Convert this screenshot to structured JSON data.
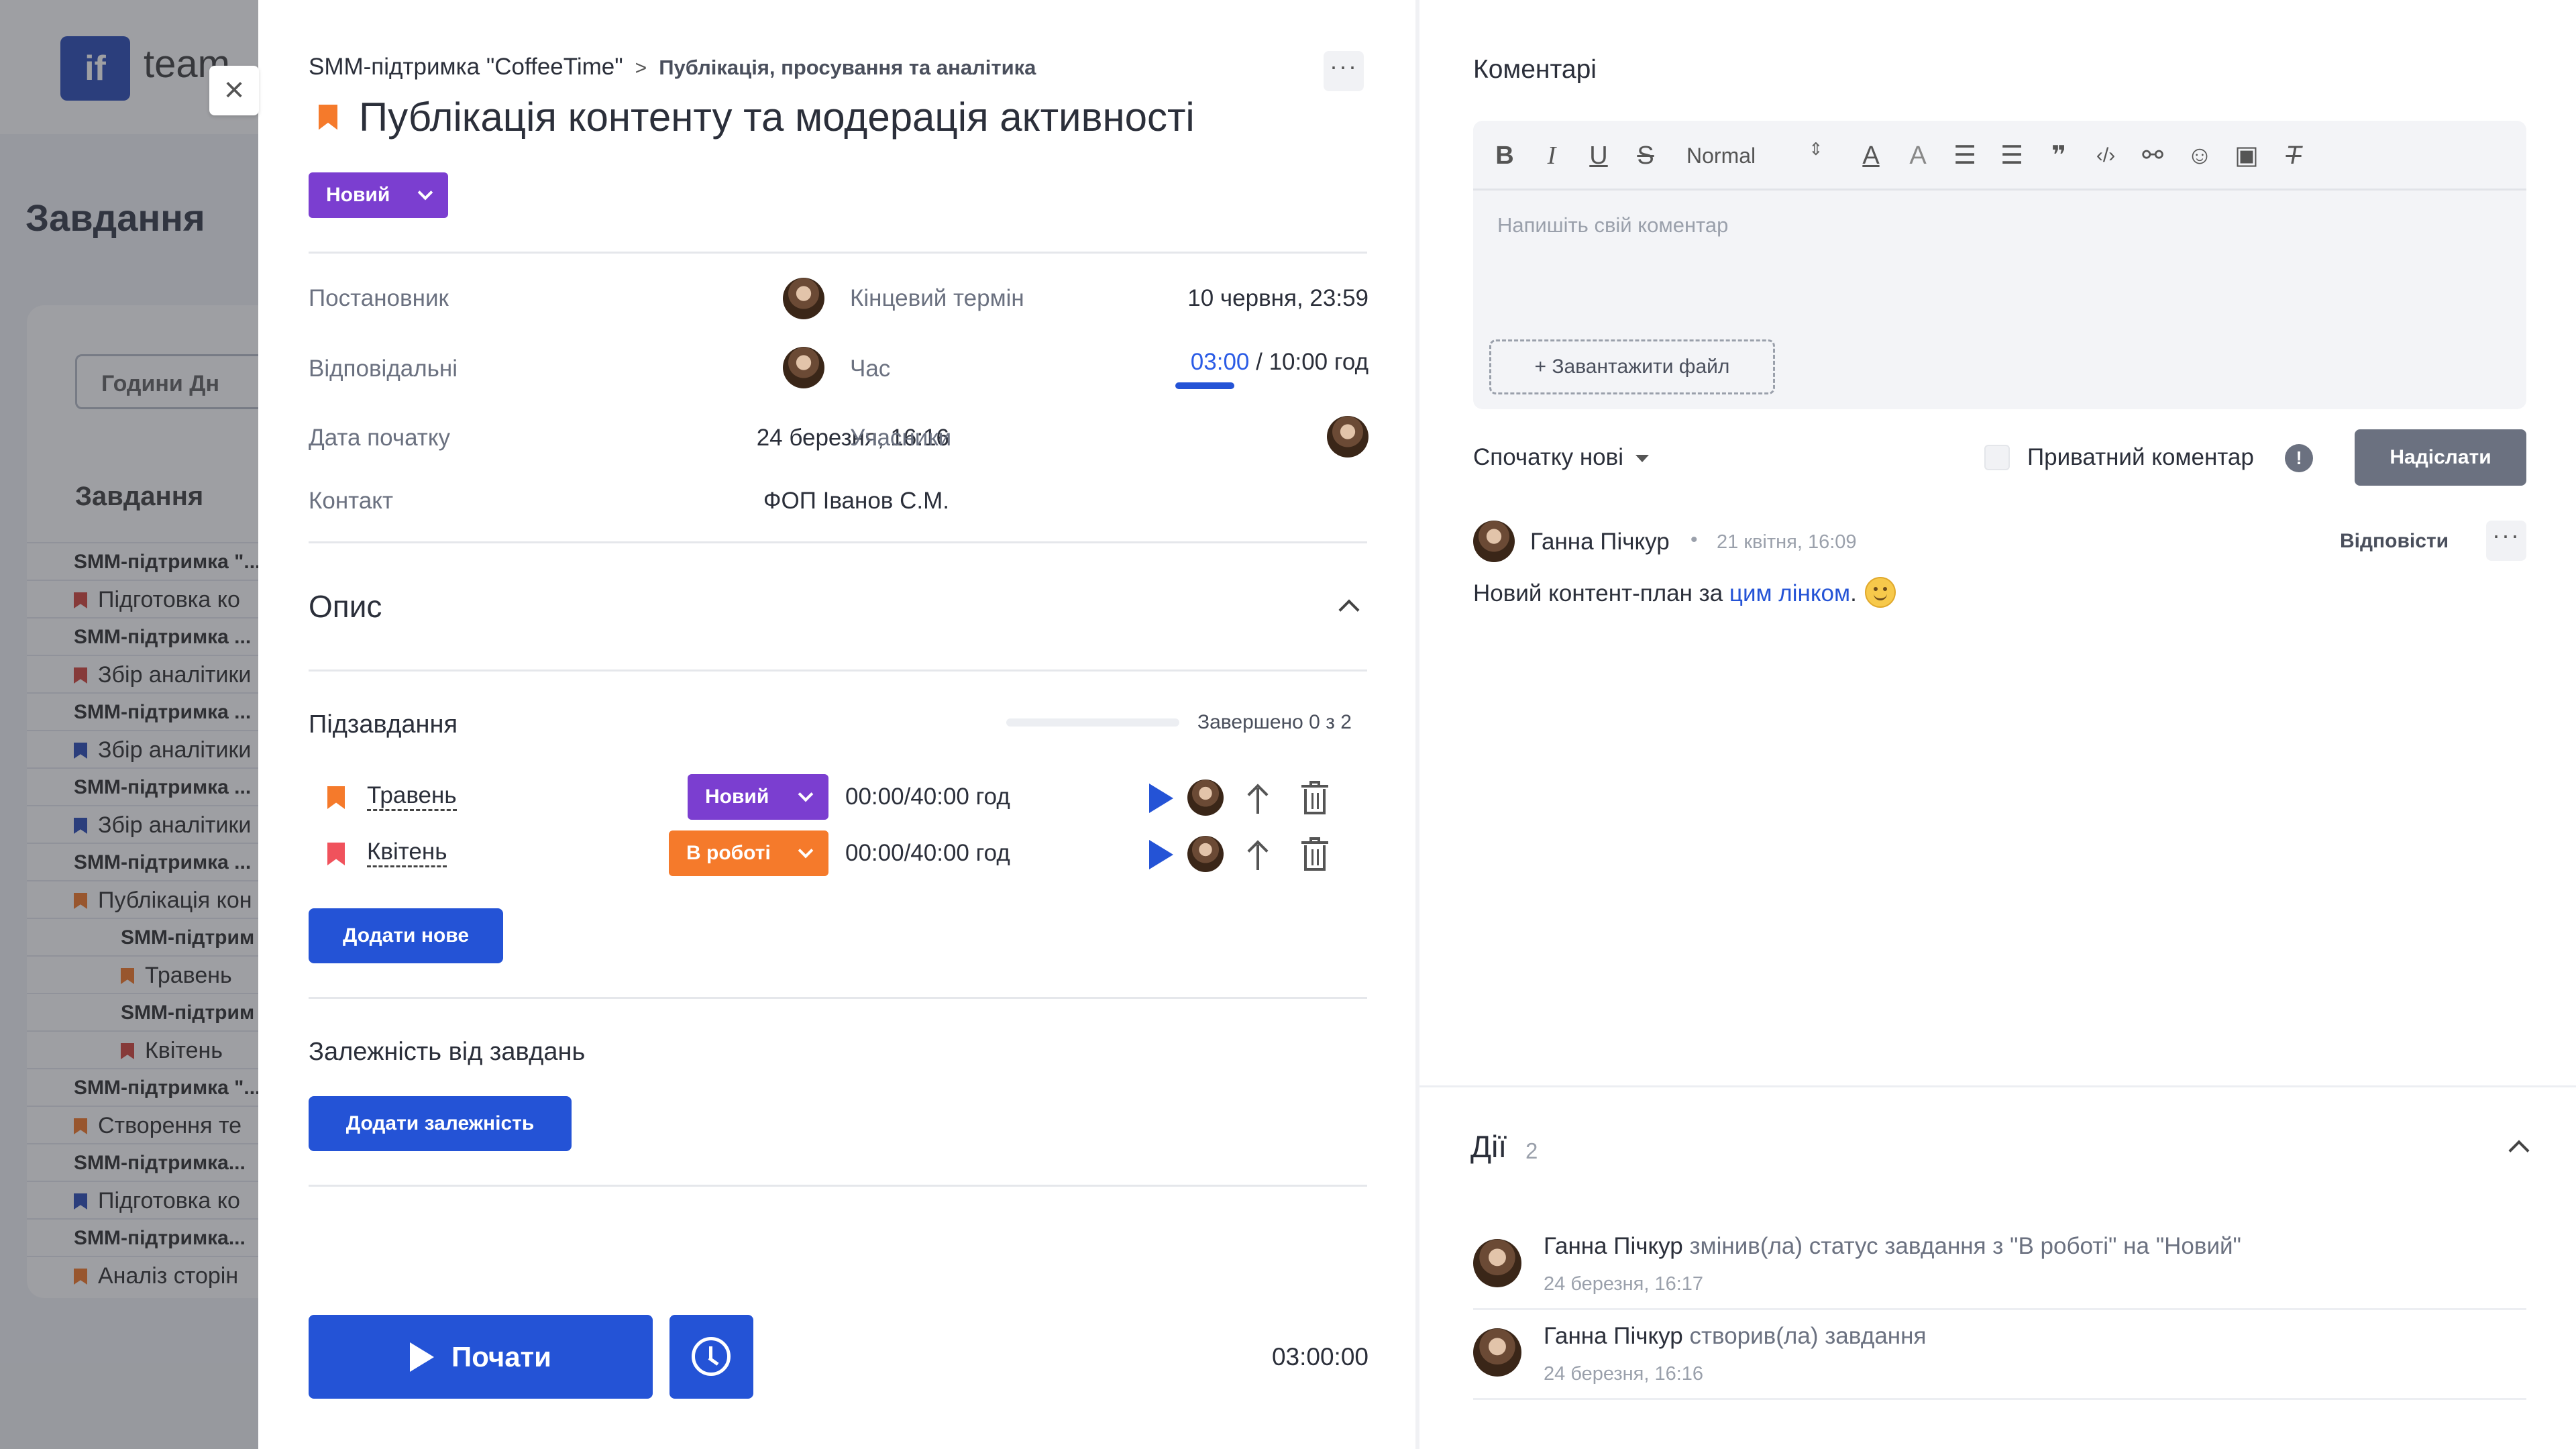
{
  "background": {
    "logo_glyph": "if",
    "logo_text": "team",
    "page_title": "Завдання",
    "hours_label": "Години   Дн",
    "tasks_label": "Завдання",
    "list": [
      {
        "text": "SMM-підтримка \"...",
        "group": true,
        "child": false,
        "flag": ""
      },
      {
        "text": "Підготовка ко",
        "group": false,
        "child": false,
        "flag": "#d4473f"
      },
      {
        "text": "SMM-підтримка ...",
        "group": true,
        "child": false,
        "flag": ""
      },
      {
        "text": "Збір аналітики",
        "group": false,
        "child": false,
        "flag": "#d4473f"
      },
      {
        "text": "SMM-підтримка ...",
        "group": true,
        "child": false,
        "flag": ""
      },
      {
        "text": "Збір аналітики",
        "group": false,
        "child": false,
        "flag": "#2e4fb8"
      },
      {
        "text": "SMM-підтримка ...",
        "group": true,
        "child": false,
        "flag": ""
      },
      {
        "text": "Збір аналітики",
        "group": false,
        "child": false,
        "flag": "#2e4fb8"
      },
      {
        "text": "SMM-підтримка ...",
        "group": true,
        "child": false,
        "flag": ""
      },
      {
        "text": "Публікація кон",
        "group": false,
        "child": false,
        "flag": "#f57a2b"
      },
      {
        "text": "SMM-підтрим",
        "group": true,
        "child": true,
        "flag": ""
      },
      {
        "text": "Травень",
        "group": false,
        "child": true,
        "flag": "#f57a2b"
      },
      {
        "text": "SMM-підтрим",
        "group": true,
        "child": true,
        "flag": ""
      },
      {
        "text": "Квітень",
        "group": false,
        "child": true,
        "flag": "#d4473f"
      },
      {
        "text": "SMM-підтримка \"...",
        "group": true,
        "child": false,
        "flag": ""
      },
      {
        "text": "Створення те",
        "group": false,
        "child": false,
        "flag": "#f57a2b"
      },
      {
        "text": "SMM-підтримка...",
        "group": true,
        "child": false,
        "flag": ""
      },
      {
        "text": "Підготовка ко",
        "group": false,
        "child": false,
        "flag": "#2e4fb8"
      },
      {
        "text": "SMM-підтримка...",
        "group": true,
        "child": false,
        "flag": ""
      },
      {
        "text": "Аналіз сторін",
        "group": false,
        "child": false,
        "flag": "#f57a2b"
      }
    ]
  },
  "task": {
    "breadcrumb_project": "SMM-підтримка \"CoffeeTime\"",
    "breadcrumb_separator": ">",
    "breadcrumb_section": "Публікація, просування та аналітика",
    "more_glyph": "···",
    "title": "Публікація контенту та модерація активності",
    "status": "Новий",
    "fields": {
      "creator_label": "Постановник",
      "deadline_label": "Кінцевий термін",
      "deadline_value": "10 червня, 23:59",
      "assignee_label": "Відповідальні",
      "time_label": "Час",
      "time_spent": "03:00",
      "time_rest": " / 10:00 год",
      "start_label": "Дата початку",
      "start_value": "24 березня, 16:16",
      "participants_label": "Учасники",
      "contact_label": "Контакт",
      "contact_value": "ФОП Іванов С.М."
    },
    "description_title": "Опис",
    "subtasks_title": "Підзавдання",
    "subtasks_done": "Завершено 0 з 2",
    "subtasks": [
      {
        "name": "Травень",
        "status": "Новий",
        "time": "00:00/40:00 год",
        "flag": "#f57a2b"
      },
      {
        "name": "Квітень",
        "status": "В роботі",
        "time": "00:00/40:00 год",
        "flag": "#f0525c"
      }
    ],
    "add_subtask": "Додати нове",
    "dependencies_title": "Залежність від завдань",
    "add_dependency": "Додати залежність",
    "start_button": "Почати",
    "timer": "03:00:00"
  },
  "comments": {
    "title": "Коментарі",
    "toolbar": {
      "bold": "B",
      "italic": "I",
      "underline": "U",
      "strike": "S",
      "normal": "Normal",
      "updown": "⇕",
      "color": "A",
      "bg": "A",
      "ol": "☰",
      "ul": "☰",
      "quote": "❞",
      "code": "‹/›",
      "link": "⚯",
      "emoji": "☺",
      "image": "▣",
      "clear": "T"
    },
    "placeholder": "Напишіть свій коментар",
    "upload": "+ Завантажити файл",
    "sort": "Спочатку нові",
    "private_label": "Приватний коментар",
    "info_glyph": "!",
    "send": "Надіслати",
    "items": [
      {
        "author": "Ганна Пічкур",
        "dot": "•",
        "date": "21 квітня, 16:09",
        "reply": "Відповісти",
        "text_before": "Новий контент-план за ",
        "link": "цим лінком",
        "text_after": "."
      }
    ]
  },
  "actions": {
    "title": "Дії",
    "count": "2",
    "items": [
      {
        "author": "Ганна Пічкур",
        "text": " змінив(ла) статус завдання з \"В роботі\" на \"Новий\"",
        "date": "24 березня, 16:17"
      },
      {
        "author": "Ганна Пічкур",
        "text": " створив(ла) завдання",
        "date": "24 березня, 16:16"
      }
    ]
  },
  "colors": {
    "accent": "#2453d6",
    "status_new": "#7b3ed0",
    "status_in_progress": "#f57a2b",
    "flag_orange": "#f57a2b",
    "send_disabled": "#6b7180"
  }
}
